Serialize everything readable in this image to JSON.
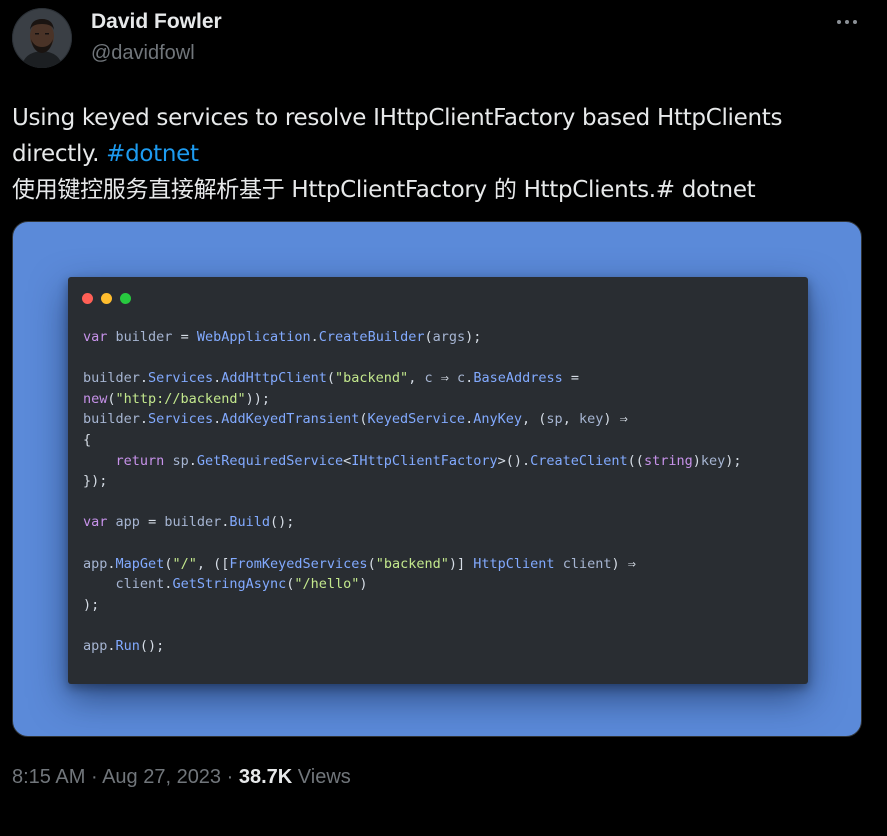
{
  "author": {
    "name": "David Fowler",
    "handle": "@davidfowl"
  },
  "tweet": {
    "text_line1": "Using keyed services to resolve IHttpClientFactory based HttpClients",
    "text_line2": "directly. ",
    "hashtag": "#dotnet",
    "text_line3": "使用键控服务直接解析基于 HttpClientFactory 的 HttpClients.# dotnet"
  },
  "code": {
    "lines": [
      "var builder = WebApplication.CreateBuilder(args);",
      "",
      "builder.Services.AddHttpClient(\"backend\", c ⇒ c.BaseAddress =",
      "new(\"http://backend\"));",
      "builder.Services.AddKeyedTransient(KeyedService.AnyKey, (sp, key) ⇒",
      "{",
      "    return sp.GetRequiredService<IHttpClientFactory>().CreateClient((string)key);",
      "});",
      "",
      "var app = builder.Build();",
      "",
      "app.MapGet(\"/\", ([FromKeyedServices(\"backend\")] HttpClient client) ⇒",
      "    client.GetStringAsync(\"/hello\")",
      ");",
      "",
      "app.Run();"
    ]
  },
  "meta": {
    "time": "8:15 AM",
    "separator": " · ",
    "date": "Aug 27, 2023",
    "views_count": "38.7K",
    "views_label": " Views"
  },
  "colors": {
    "background": "#000000",
    "link": "#1d9bf0",
    "media_bg": "#5b8ad9",
    "code_bg": "#292d32",
    "dot_red": "#ff5f56",
    "dot_yellow": "#ffbd2e",
    "dot_green": "#27c93f"
  },
  "icons": {
    "more": "more-horizontal-icon",
    "window_controls": "traffic-light-dots"
  }
}
